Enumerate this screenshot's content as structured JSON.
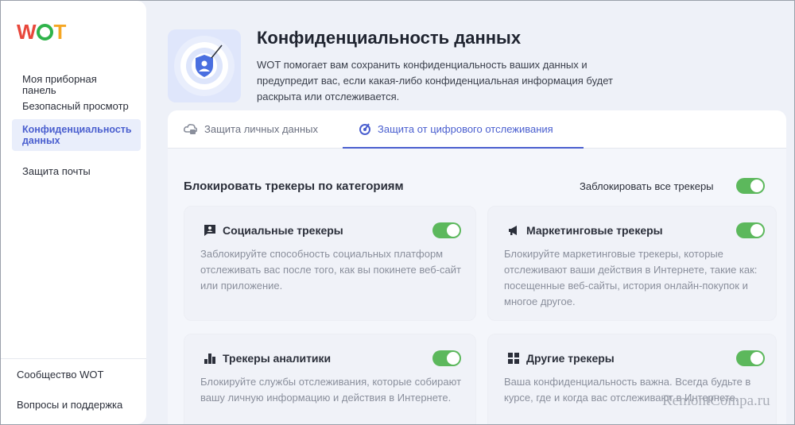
{
  "logo": {
    "w": "W",
    "t": "T"
  },
  "sidebar": {
    "items": [
      {
        "label": "Моя приборная панель"
      },
      {
        "label": "Безопасный просмотр"
      },
      {
        "label": "Конфиденциальность данных"
      },
      {
        "label": "Защита почты"
      }
    ],
    "bottom": [
      {
        "label": "Сообщество WOT"
      },
      {
        "label": "Вопросы и поддержка"
      }
    ]
  },
  "header": {
    "title": "Конфиденциальность данных",
    "description": "WOT помогает вам сохранить конфиденциальность ваших данных и предупредит вас, если какая-либо конфиденциальная информация будет раскрыта или отслеживается."
  },
  "tabs": [
    {
      "label": "Защита личных данных",
      "icon": "cloud-lock-icon"
    },
    {
      "label": "Защита от цифрового отслеживания",
      "icon": "radar-icon"
    }
  ],
  "section": {
    "title": "Блокировать трекеры по категориям",
    "block_all_label": "Заблокировать все трекеры",
    "block_all_on": true
  },
  "cards": [
    {
      "title": "Социальные трекеры",
      "icon": "social-icon",
      "on": true,
      "description": "Заблокируйте способность социальных платформ отслеживать вас после того, как вы покинете веб-сайт или приложение."
    },
    {
      "title": "Маркетинговые трекеры",
      "icon": "megaphone-icon",
      "on": true,
      "description": "Блокируйте маркетинговые трекеры, которые отслеживают ваши действия в Интернете, такие как: посещенные веб-сайты, история онлайн-покупок и многое другое."
    },
    {
      "title": "Трекеры аналитики",
      "icon": "bar-chart-icon",
      "on": true,
      "description": "Блокируйте службы отслеживания, которые собирают вашу личную информацию и действия в Интернете."
    },
    {
      "title": "Другие трекеры",
      "icon": "grid-icon",
      "on": true,
      "description": "Ваша конфиденциальность важна. Всегда будьте в курсе, где и когда вас отслеживают в Интернете."
    }
  ],
  "watermark": "RemontCompa.ru",
  "colors": {
    "accent": "#4a5fcf",
    "toggle_on": "#5cb85c",
    "background": "#eef1f8"
  }
}
